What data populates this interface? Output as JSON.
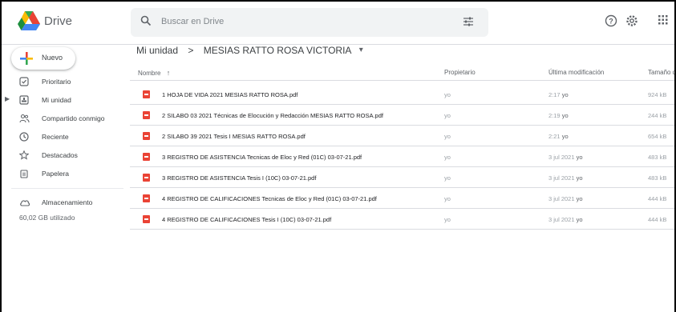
{
  "app": {
    "title": "Drive"
  },
  "search": {
    "placeholder": "Buscar en Drive"
  },
  "sidebar": {
    "new_label": "Nuevo",
    "items": [
      {
        "label": "Prioritario"
      },
      {
        "label": "Mi unidad"
      },
      {
        "label": "Compartido conmigo"
      },
      {
        "label": "Reciente"
      },
      {
        "label": "Destacados"
      },
      {
        "label": "Papelera"
      }
    ],
    "storage_label": "Almacenamiento",
    "storage_used": "60,02 GB utilizado"
  },
  "breadcrumb": {
    "root": "Mi unidad",
    "separator": ">",
    "current": "MESIAS RATTO ROSA VICTORIA",
    "dropdown": "▾"
  },
  "table": {
    "headers": {
      "name": "Nombre",
      "sort_arrow": "↑",
      "owner": "Propietario",
      "modified": "Última modificación",
      "size": "Tamaño d"
    },
    "rows": [
      {
        "name": "1 HOJA DE VIDA 2021 MESIAS RATTO ROSA.pdf",
        "owner": "yo",
        "date": "2:17",
        "by": "yo",
        "size": "924 kB"
      },
      {
        "name": "2 SILABO 03 2021 Técnicas de Elocución y Redacción MESIAS RATTO ROSA.pdf",
        "owner": "yo",
        "date": "2:19",
        "by": "yo",
        "size": "244 kB"
      },
      {
        "name": "2 SILABO 39 2021 Tesis I  MESIAS RATTO ROSA.pdf",
        "owner": "yo",
        "date": "2:21",
        "by": "yo",
        "size": "654 kB"
      },
      {
        "name": "3 REGISTRO DE ASISTENCIA  Tecnicas de Eloc y Red (01C) 03-07-21.pdf",
        "owner": "yo",
        "date": "3 jul 2021",
        "by": "yo",
        "size": "483 kB"
      },
      {
        "name": "3 REGISTRO DE ASISTENCIA  Tesis I  (10C) 03-07-21.pdf",
        "owner": "yo",
        "date": "3 jul 2021",
        "by": "yo",
        "size": "483 kB"
      },
      {
        "name": "4 REGISTRO DE CALIFICACIONES  Tecnicas de Eloc y Red (01C) 03-07-21.pdf",
        "owner": "yo",
        "date": "3 jul 2021",
        "by": "yo",
        "size": "444 kB"
      },
      {
        "name": "4 REGISTRO DE CALIFICACIONES Tesis I  (10C) 03-07-21.pdf",
        "owner": "yo",
        "date": "3 jul 2021",
        "by": "yo",
        "size": "444 kB"
      }
    ]
  },
  "colors": {
    "accent_blue": "#1a73e8",
    "pdf_red": "#ea4335",
    "search_bg": "#f1f3f4",
    "divider": "#dadce0"
  },
  "icons": [
    "drive-logo-icon",
    "search-icon",
    "tune-icon",
    "help-icon",
    "settings-icon",
    "apps-grid-icon",
    "plus-icon",
    "priority-icon",
    "my-drive-icon",
    "shared-icon",
    "recent-icon",
    "star-icon",
    "trash-icon",
    "cloud-icon",
    "pdf-icon"
  ]
}
